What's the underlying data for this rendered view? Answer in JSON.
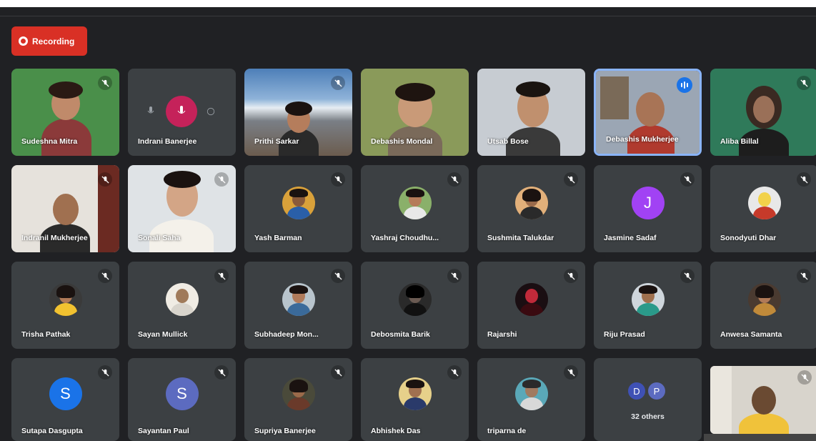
{
  "recording": {
    "label": "Recording"
  },
  "participants": [
    "Sudeshna Mitra",
    "Indrani Banerjee",
    "Prithi Sarkar",
    "Debashis Mondal",
    "Utsab Bose",
    "Debashis Mukherjee",
    "Aliba Billal",
    "Indranil Mukherjee",
    "Sonali Saha",
    "Yash Barman",
    "Yashraj Choudhu...",
    "Sushmita Talukdar",
    "Jasmine Sadaf",
    "Sonodyuti Dhar",
    "Trisha Pathak",
    "Sayan Mullick",
    "Subhadeep Mon...",
    "Debosmita Barik",
    "Rajarshi",
    "Riju Prasad",
    "Anwesa Samanta",
    "Sutapa Dasgupta",
    "Sayantan Paul",
    "Supriya Banerjee",
    "Abhishek Das",
    "triparna de"
  ],
  "avatar_letters": {
    "jasmine": "J",
    "sutapa": "S",
    "sayantan": "S",
    "others_d": "D",
    "others_p": "P"
  },
  "others": {
    "label": "32 others"
  },
  "colors": {
    "background": "#202124",
    "tile": "#3c4043",
    "recording": "#d93025",
    "speaking_border": "#8ab4f8",
    "jasmine": "#a142f4",
    "sutapa": "#1a73e8",
    "sayantan": "#5c6bc0"
  }
}
